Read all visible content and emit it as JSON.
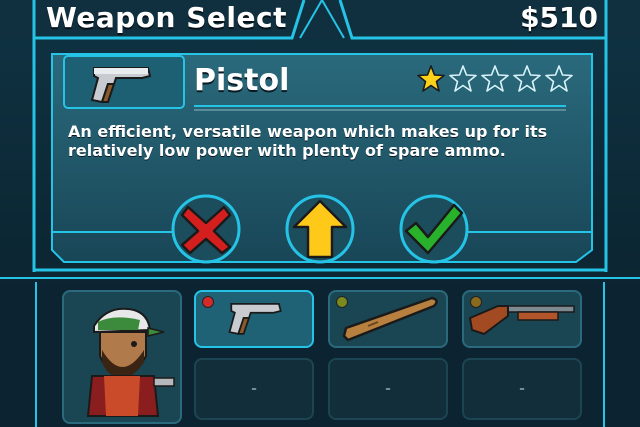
{
  "header": {
    "title": "Weapon Select",
    "money": "$510"
  },
  "weapon": {
    "name": "Pistol",
    "rating": 1,
    "rating_max": 5,
    "description": "An efficient, versatile weapon which makes up for its relatively low power with plenty of spare ammo."
  },
  "actions": [
    {
      "icon": "cross-icon",
      "name": "cancel-button"
    },
    {
      "icon": "up-arrow-icon",
      "name": "upgrade-button"
    },
    {
      "icon": "checkmark-icon",
      "name": "confirm-button"
    }
  ],
  "inventory": {
    "character": "survivor-character",
    "slots": [
      {
        "icon": "pistol-icon",
        "selected": true,
        "dot": "#d62a2a",
        "empty_text": ""
      },
      {
        "icon": "baseball-bat-icon",
        "selected": false,
        "dot": "#7a8a1e",
        "empty_text": ""
      },
      {
        "icon": "shotgun-icon",
        "selected": false,
        "dot": "#8a6a1c",
        "empty_text": ""
      },
      {
        "icon": "",
        "selected": false,
        "dot": "",
        "empty_text": "-"
      },
      {
        "icon": "",
        "selected": false,
        "dot": "",
        "empty_text": "-"
      },
      {
        "icon": "",
        "selected": false,
        "dot": "",
        "empty_text": "-"
      }
    ]
  },
  "colors": {
    "frame_cyan": "#25c3e6",
    "panel_fill": "#1f5566",
    "bg_dark": "#0b1f2b",
    "star_gold": "#ffd21a",
    "red": "#d51f1f",
    "yellow": "#ffc91a",
    "green": "#28b22c"
  }
}
